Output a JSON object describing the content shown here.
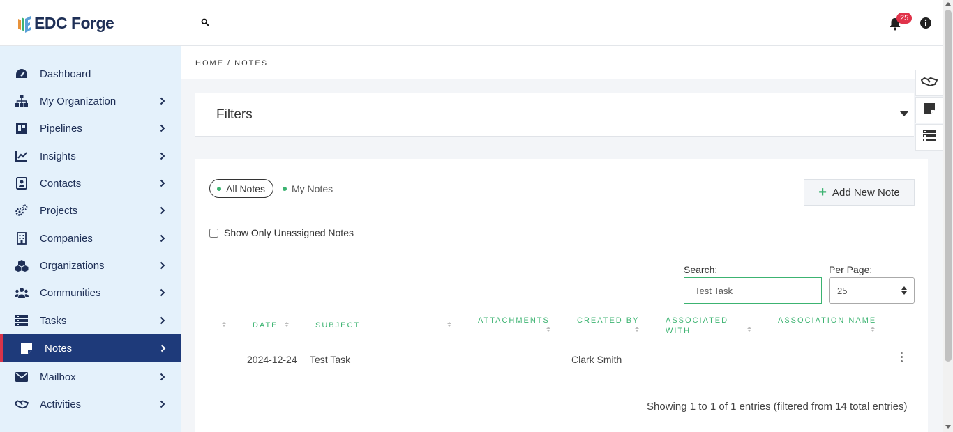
{
  "app": {
    "brand": "EDC Forge",
    "notifications_count": "25"
  },
  "sidebar": {
    "items": [
      {
        "label": "Dashboard",
        "icon": "dashboard-gauge-icon"
      },
      {
        "label": "My Organization",
        "icon": "org-chart-icon"
      },
      {
        "label": "Pipelines",
        "icon": "kanban-board-icon"
      },
      {
        "label": "Insights",
        "icon": "line-chart-icon"
      },
      {
        "label": "Contacts",
        "icon": "contact-card-icon"
      },
      {
        "label": "Projects",
        "icon": "gears-icon"
      },
      {
        "label": "Companies",
        "icon": "building-icon"
      },
      {
        "label": "Organizations",
        "icon": "cubes-icon"
      },
      {
        "label": "Communities",
        "icon": "users-icon"
      },
      {
        "label": "Tasks",
        "icon": "list-bars-icon"
      },
      {
        "label": "Notes",
        "icon": "sticky-note-icon",
        "active": true
      },
      {
        "label": "Mailbox",
        "icon": "envelope-icon"
      },
      {
        "label": "Activities",
        "icon": "handshake-icon"
      }
    ]
  },
  "breadcrumb": "HOME / NOTES",
  "filters": {
    "title": "Filters"
  },
  "notes": {
    "tabs": {
      "all": "All Notes",
      "my": "My Notes"
    },
    "add_button": "Add New Note",
    "unassigned_label": "Show Only Unassigned Notes",
    "search_label": "Search:",
    "search_value": "Test Task",
    "per_page_label": "Per Page:",
    "per_page_value": "25",
    "columns": {
      "date": "DATE",
      "subject": "SUBJECT",
      "attachments": "ATTACHMENTS",
      "created_by": "CREATED BY",
      "associated_with_1": "ASSOCIATED",
      "associated_with_2": "WITH",
      "association_name": "ASSOCIATION NAME"
    },
    "rows": [
      {
        "date": "2024-12-24",
        "subject": "Test Task",
        "attachments": "",
        "created_by": "Clark Smith",
        "associated_with": "",
        "association_name": ""
      }
    ],
    "showing": "Showing 1 to 1 of 1 entries (filtered from 14 total entries)"
  },
  "colors": {
    "accent_green": "#3cb371",
    "sidebar_bg": "#e4f1fb",
    "active_bg": "#1e3a7a",
    "active_border": "#d9344a",
    "navy": "#1e2f56"
  }
}
